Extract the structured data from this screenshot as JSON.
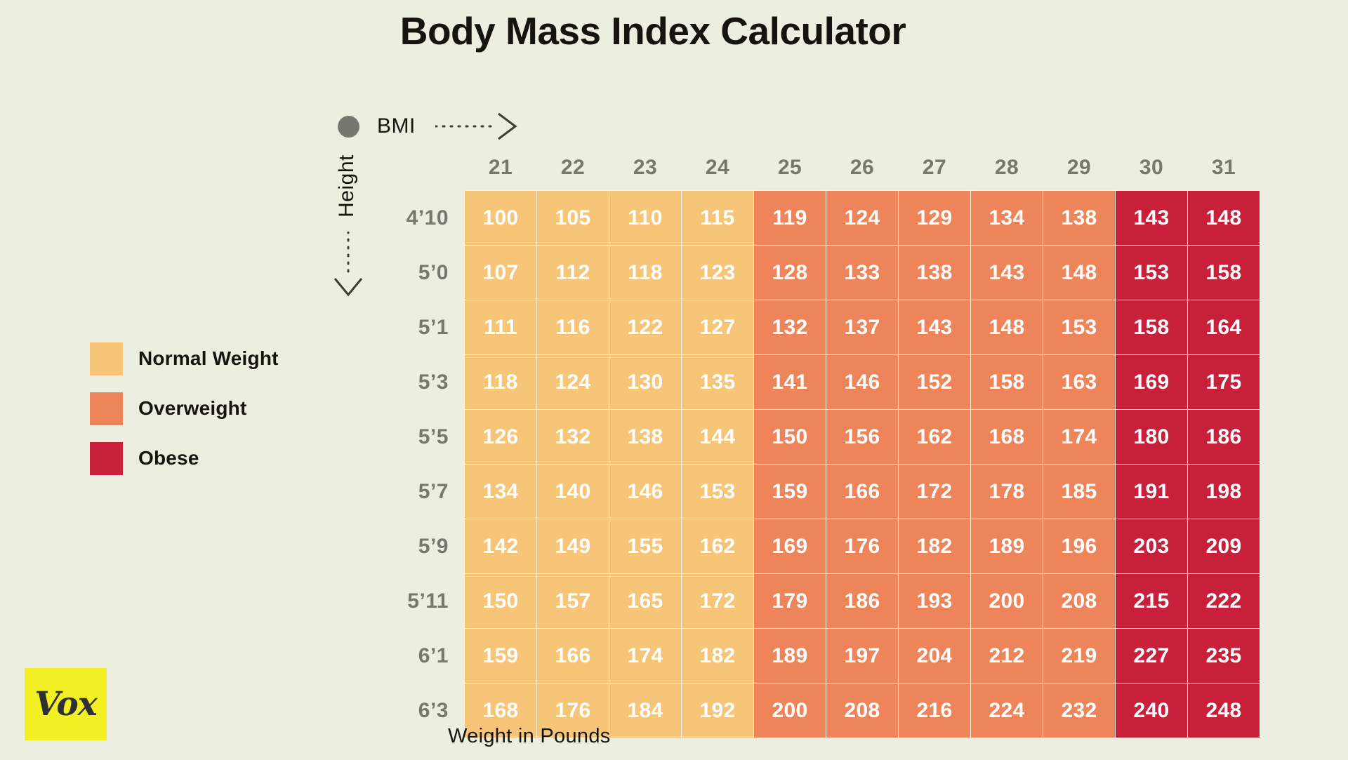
{
  "title": "Body Mass Index Calculator",
  "axes": {
    "bmi_label": "BMI",
    "height_label": "Height",
    "weight_caption": "Weight in Pounds"
  },
  "legend": [
    {
      "label": "Normal Weight",
      "color": "#f6c578"
    },
    {
      "label": "Overweight",
      "color": "#ee8459"
    },
    {
      "label": "Obese",
      "color": "#c8203b"
    }
  ],
  "branding": {
    "logo_text": "Vox",
    "logo_background": "#f2ef22"
  },
  "colors": {
    "page_background": "#ecefdf",
    "header_text": "#76776e",
    "cell_text": "#ffffff",
    "gridline": "#f6f3e6",
    "bmi_dot": "#76776e"
  },
  "chart_data": {
    "type": "heatmap",
    "title": "Body Mass Index Calculator",
    "xlabel": "BMI",
    "ylabel": "Height",
    "caption": "Weight in Pounds",
    "categories": [
      "21",
      "22",
      "23",
      "24",
      "25",
      "26",
      "27",
      "28",
      "29",
      "30",
      "31"
    ],
    "rows": [
      "4’10",
      "5’0",
      "5’1",
      "5’3",
      "5’5",
      "5’7",
      "5’9",
      "5’11",
      "6’1",
      "6’3"
    ],
    "legend_position": "left",
    "grid": true,
    "category_colors": {
      "normal": "#f6c578",
      "overweight": "#ee8459",
      "obese": "#c8203b"
    },
    "category_breaks": {
      "normal_max_bmi": 24,
      "overweight_max_bmi": 29,
      "obese_min_bmi": 30
    },
    "values": [
      [
        100,
        105,
        110,
        115,
        119,
        124,
        129,
        134,
        138,
        143,
        148
      ],
      [
        107,
        112,
        118,
        123,
        128,
        133,
        138,
        143,
        148,
        153,
        158
      ],
      [
        111,
        116,
        122,
        127,
        132,
        137,
        143,
        148,
        153,
        158,
        164
      ],
      [
        118,
        124,
        130,
        135,
        141,
        146,
        152,
        158,
        163,
        169,
        175
      ],
      [
        126,
        132,
        138,
        144,
        150,
        156,
        162,
        168,
        174,
        180,
        186
      ],
      [
        134,
        140,
        146,
        153,
        159,
        166,
        172,
        178,
        185,
        191,
        198
      ],
      [
        142,
        149,
        155,
        162,
        169,
        176,
        182,
        189,
        196,
        203,
        209
      ],
      [
        150,
        157,
        165,
        172,
        179,
        186,
        193,
        200,
        208,
        215,
        222
      ],
      [
        159,
        166,
        174,
        182,
        189,
        197,
        204,
        212,
        219,
        227,
        235
      ],
      [
        168,
        176,
        184,
        192,
        200,
        208,
        216,
        224,
        232,
        240,
        248
      ]
    ]
  }
}
